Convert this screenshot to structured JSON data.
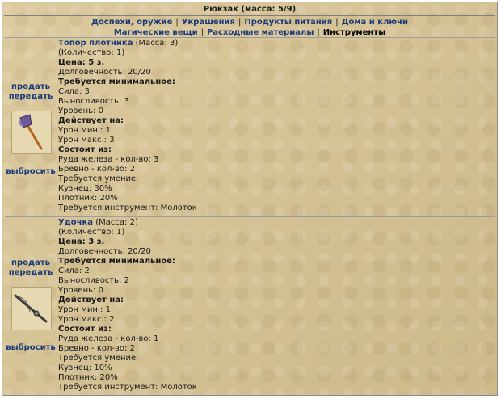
{
  "header": {
    "title": "Рюкзак (масса: 5/9)"
  },
  "categories": {
    "row1": [
      "Доспехи, оружие",
      "Украшения",
      "Продукты питания",
      "Дома и ключи"
    ],
    "row2": [
      "Магические вещи",
      "Расходные материалы"
    ],
    "active": "Инструменты"
  },
  "actions": {
    "sell": "продать",
    "give": "передать",
    "drop": "выбросить"
  },
  "items": [
    {
      "name": "Топор плотника",
      "mass": "(Масса: 3)",
      "count": "(Количество: 1)",
      "price": "Цена: 5 з.",
      "durability": "Долговечность: 20/20",
      "req_title": "Требуется минимальное:",
      "strength": "Сила: 3",
      "stamina": "Выносливость: 3",
      "level": "Уровень: 0",
      "effect_title": "Действует на:",
      "dmg_min": "Урон мин.: 1",
      "dmg_max": "Урон макс.: 3",
      "consist_title": "Состоит из:",
      "ore": "Руда железа - кол-во: 3",
      "log": "Бревно - кол-во: 2",
      "skill_title": "Требуется умение:",
      "smith": "Кузнец: 30%",
      "carpenter": "Плотник: 20%",
      "tool": "Требуется инструмент: Молоток",
      "icon": "axe-icon"
    },
    {
      "name": "Удочка",
      "mass": "(Масса: 2)",
      "count": "(Количество: 1)",
      "price": "Цена: 3 з.",
      "durability": "Долговечность: 20/20",
      "req_title": "Требуется минимальное:",
      "strength": "Сила: 2",
      "stamina": "Выносливость: 2",
      "level": "Уровень: 0",
      "effect_title": "Действует на:",
      "dmg_min": "Урон мин.: 1",
      "dmg_max": "Урон макс.: 2",
      "consist_title": "Состоит из:",
      "ore": "Руда железа - кол-во: 1",
      "log": "Бревно - кол-во: 2",
      "skill_title": "Требуется умение:",
      "smith": "Кузнец: 10%",
      "carpenter": "Плотник: 20%",
      "tool": "Требуется инструмент: Молоток",
      "icon": "fishing-rod-icon"
    }
  ],
  "colors": {
    "link": "#1b3a7a",
    "background": "#d8c79a",
    "border": "#8a8a8a"
  }
}
